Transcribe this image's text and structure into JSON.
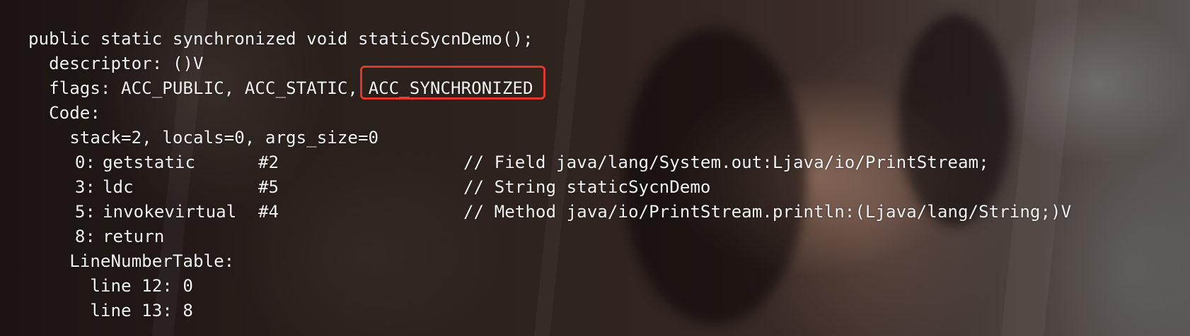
{
  "code": {
    "method_signature": "public static synchronized void staticSycnDemo();",
    "descriptor": "descriptor: ()V",
    "flags_prefix": "flags: ACC_PUBLIC, ACC_STATIC, ",
    "flags_highlighted": "ACC_SYNCHRONIZED",
    "code_label": "Code:",
    "stack_info": "stack=2, locals=0, args_size=0",
    "instructions": [
      {
        "offset": "0:",
        "opcode": "getstatic",
        "operand": "#2",
        "comment": "// Field java/lang/System.out:Ljava/io/PrintStream;"
      },
      {
        "offset": "3:",
        "opcode": "ldc",
        "operand": "#5",
        "comment": "// String staticSycnDemo"
      },
      {
        "offset": "5:",
        "opcode": "invokevirtual",
        "operand": "#4",
        "comment": "// Method java/io/PrintStream.println:(Ljava/lang/String;)V"
      },
      {
        "offset": "8:",
        "opcode": "return",
        "operand": "",
        "comment": ""
      }
    ],
    "line_number_table_label": "LineNumberTable:",
    "line_numbers": [
      "line 12: 0",
      "line 13: 8"
    ]
  },
  "colors": {
    "text": "#f1f1f1",
    "highlight_border": "#e0362c"
  }
}
